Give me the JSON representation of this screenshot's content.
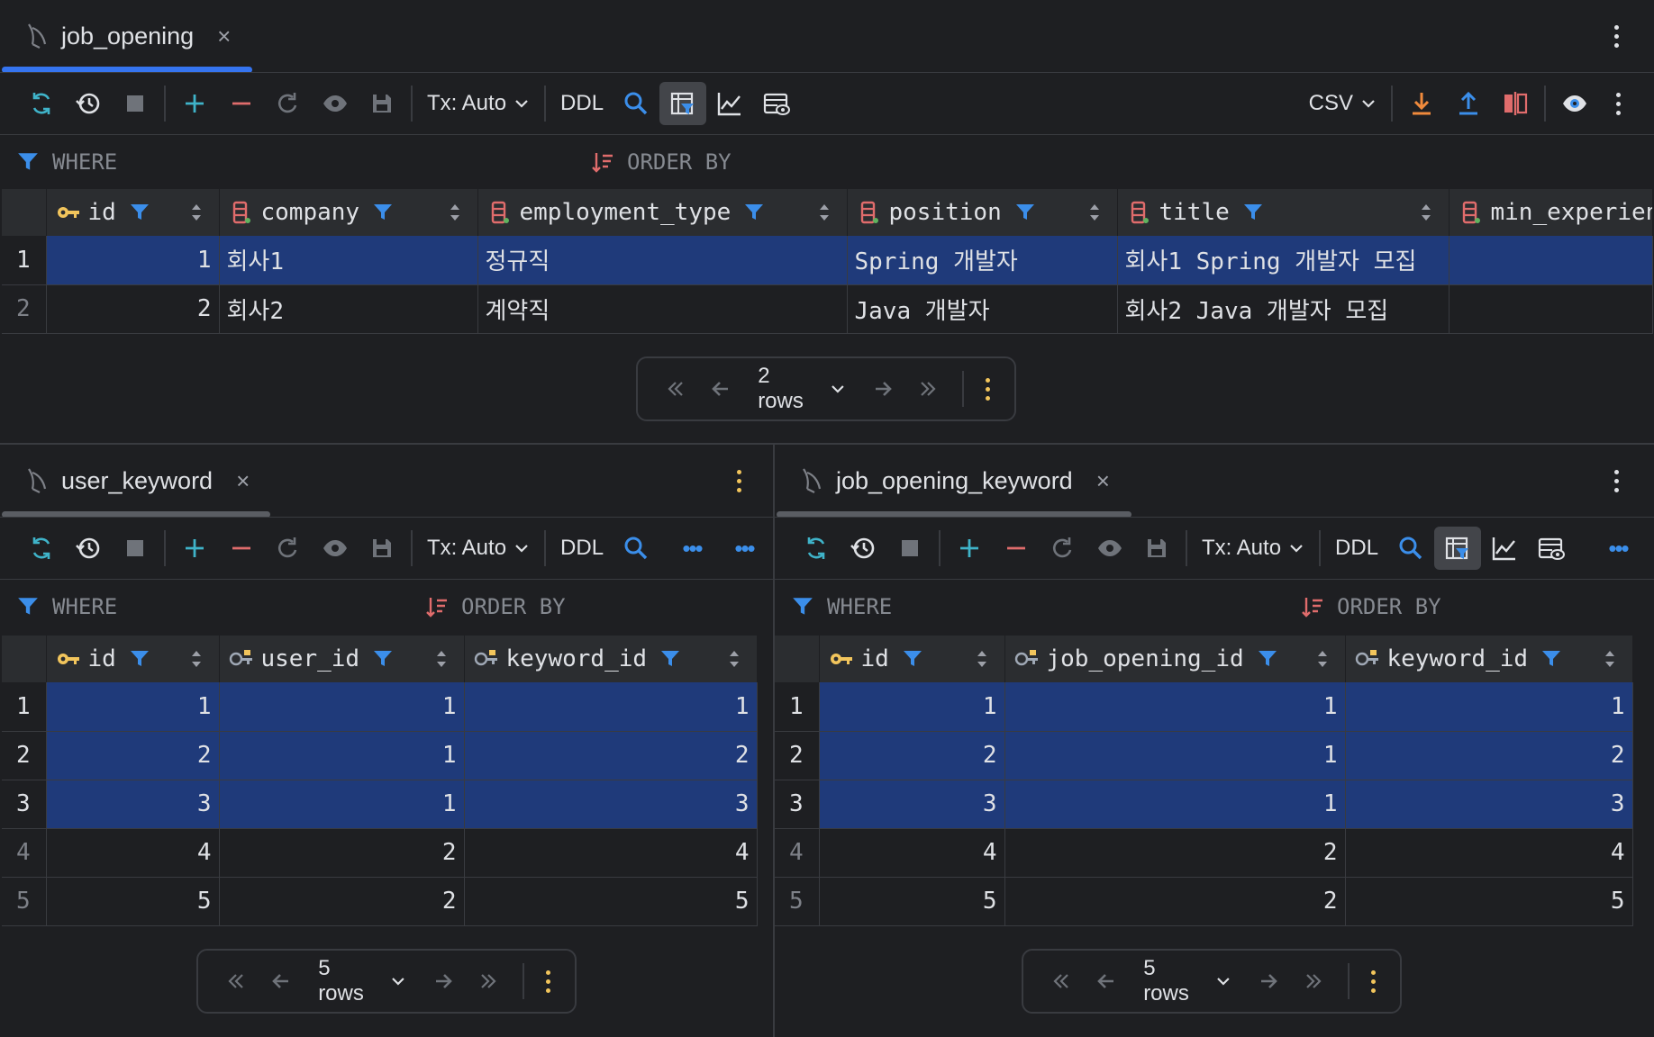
{
  "colors": {
    "accent": "#3574f0",
    "selection": "#1f3a7a",
    "filter_icon": "#3b8eea",
    "key_icon": "#f2c55c",
    "column_icon": "#e07a7a",
    "download": "#f08a3c",
    "upload": "#3b8eea"
  },
  "top": {
    "tab_title": "job_opening",
    "tab_close": "×",
    "toolbar": {
      "tx": "Tx: Auto",
      "ddl": "DDL",
      "csv": "CSV"
    },
    "where": "WHERE",
    "order_by": "ORDER BY",
    "columns": [
      {
        "name": "id",
        "icon": "key-icon"
      },
      {
        "name": "company",
        "icon": "column-icon"
      },
      {
        "name": "employment_type",
        "icon": "column-icon"
      },
      {
        "name": "position",
        "icon": "column-icon"
      },
      {
        "name": "title",
        "icon": "column-icon"
      },
      {
        "name": "min_experien",
        "icon": "column-icon"
      }
    ],
    "rows": [
      {
        "rn": "1",
        "id": "1",
        "company": "회사1",
        "employment_type": "정규직",
        "position": "Spring 개발자",
        "title": "회사1 Spring 개발자 모집",
        "min": ""
      },
      {
        "rn": "2",
        "id": "2",
        "company": "회사2",
        "employment_type": "계약직",
        "position": "Java 개발자",
        "title": "회사2 Java 개발자 모집",
        "min": ""
      }
    ],
    "pager_rows": "2 rows"
  },
  "left": {
    "tab_title": "user_keyword",
    "tab_close": "×",
    "toolbar": {
      "tx": "Tx: Auto",
      "ddl": "DDL"
    },
    "where": "WHERE",
    "order_by": "ORDER BY",
    "columns": [
      "id",
      "user_id",
      "keyword_id"
    ],
    "rows": [
      {
        "rn": "1",
        "c1": "1",
        "c2": "1",
        "c3": "1"
      },
      {
        "rn": "2",
        "c1": "2",
        "c2": "1",
        "c3": "2"
      },
      {
        "rn": "3",
        "c1": "3",
        "c2": "1",
        "c3": "3"
      },
      {
        "rn": "4",
        "c1": "4",
        "c2": "2",
        "c3": "4"
      },
      {
        "rn": "5",
        "c1": "5",
        "c2": "2",
        "c3": "5"
      }
    ],
    "pager_rows": "5 rows"
  },
  "right": {
    "tab_title": "job_opening_keyword",
    "tab_close": "×",
    "toolbar": {
      "tx": "Tx: Auto",
      "ddl": "DDL"
    },
    "where": "WHERE",
    "order_by": "ORDER BY",
    "columns": [
      "id",
      "job_opening_id",
      "keyword_id"
    ],
    "rows": [
      {
        "rn": "1",
        "c1": "1",
        "c2": "1",
        "c3": "1"
      },
      {
        "rn": "2",
        "c1": "2",
        "c2": "1",
        "c3": "2"
      },
      {
        "rn": "3",
        "c1": "3",
        "c2": "1",
        "c3": "3"
      },
      {
        "rn": "4",
        "c1": "4",
        "c2": "2",
        "c3": "4"
      },
      {
        "rn": "5",
        "c1": "5",
        "c2": "2",
        "c3": "5"
      }
    ],
    "pager_rows": "5 rows"
  }
}
